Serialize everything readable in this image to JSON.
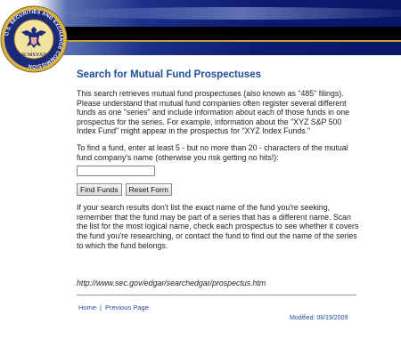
{
  "header": {
    "seal_text": "U.S. SECURITIES AND EXCHANGE COMMISSION",
    "seal_year": "MCMXXXIV",
    "brand_blue": "#0c1a6e",
    "accent_gold": "#c9a23a"
  },
  "page": {
    "title": "Search for Mutual Fund Prospectuses",
    "intro": "This search retrieves mutual fund prospectuses (also known as \"485\" filings). Please understand that mutual fund companies often register several different funds as one \"series\" and include information about each of those funds in one prospectus for the series. For example, information about the \"XYZ S&P 500 Index Fund\" might appear in the prospectus for \"XYZ Index Funds.\"",
    "instructions": "To find a fund, enter at least 5 - but no more than 20 - characters of the mutual fund company's name (otherwise you risk getting no hits!):",
    "search_value": "",
    "find_button": "Find Funds",
    "reset_button": "Reset Form",
    "note": "If your search results don't list the exact name of the fund you're seeking, remember that the fund may be part of a series that has a different name. Scan the list for the most logical name, check each prospectus to see whether it covers the fund you're researching, or contact the fund to find out the name of the series to which the fund belongs.",
    "url": "http://www.sec.gov/edgar/searchedgar/prospectus.htm"
  },
  "footer": {
    "home_link": "Home",
    "separator": "|",
    "previous_link": "Previous Page",
    "modified": "Modified: 08/19/2009"
  },
  "colors": {
    "title": "#1f4f9c",
    "link": "#1f4f9c"
  }
}
